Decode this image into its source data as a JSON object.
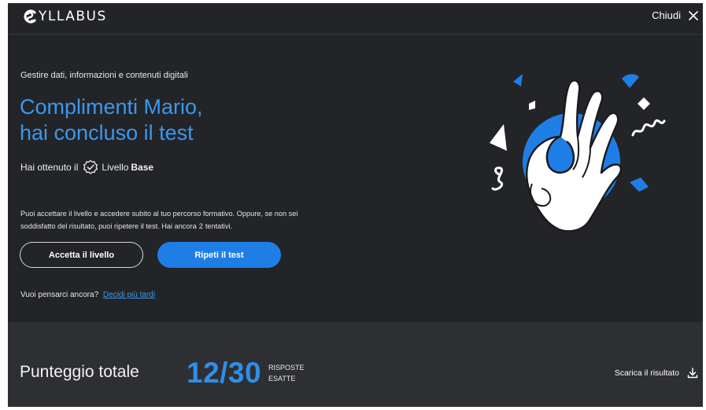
{
  "header": {
    "logo_text": "YLLABUS",
    "close_label": "Chiudi"
  },
  "hero": {
    "subject": "Gestire dati, informazioni e contenuti digitali",
    "headline_line1": "Complimenti Mario,",
    "headline_line2": "hai concluso il test",
    "level_prefix": "Hai ottenuto il",
    "level_label": "Livello",
    "level_value": "Base",
    "info_line1": "Puoi accettare il livello e accedere subito al tuo percorso formativo. Oppure, se non sei",
    "info_line2": "soddisfatto del risultato, puoi ripetere il test. Hai ancora",
    "attempts": "2",
    "attempts_suffix": "tentativi.",
    "accept_button": "Accetta il livello",
    "retry_button": "Ripeti il test",
    "later_prompt": "Vuoi pensarci ancora?",
    "later_link": "Decidi più tardi"
  },
  "score": {
    "title": "Punteggio totale",
    "value": "12/30",
    "caption_line1": "RISPOSTE",
    "caption_line2": "ESATTE",
    "download_label": "Scarica il risultato"
  },
  "colors": {
    "background": "#232427",
    "band": "#2e2f33",
    "accent": "#1f7ee6",
    "accent_text": "#3a98f0"
  }
}
